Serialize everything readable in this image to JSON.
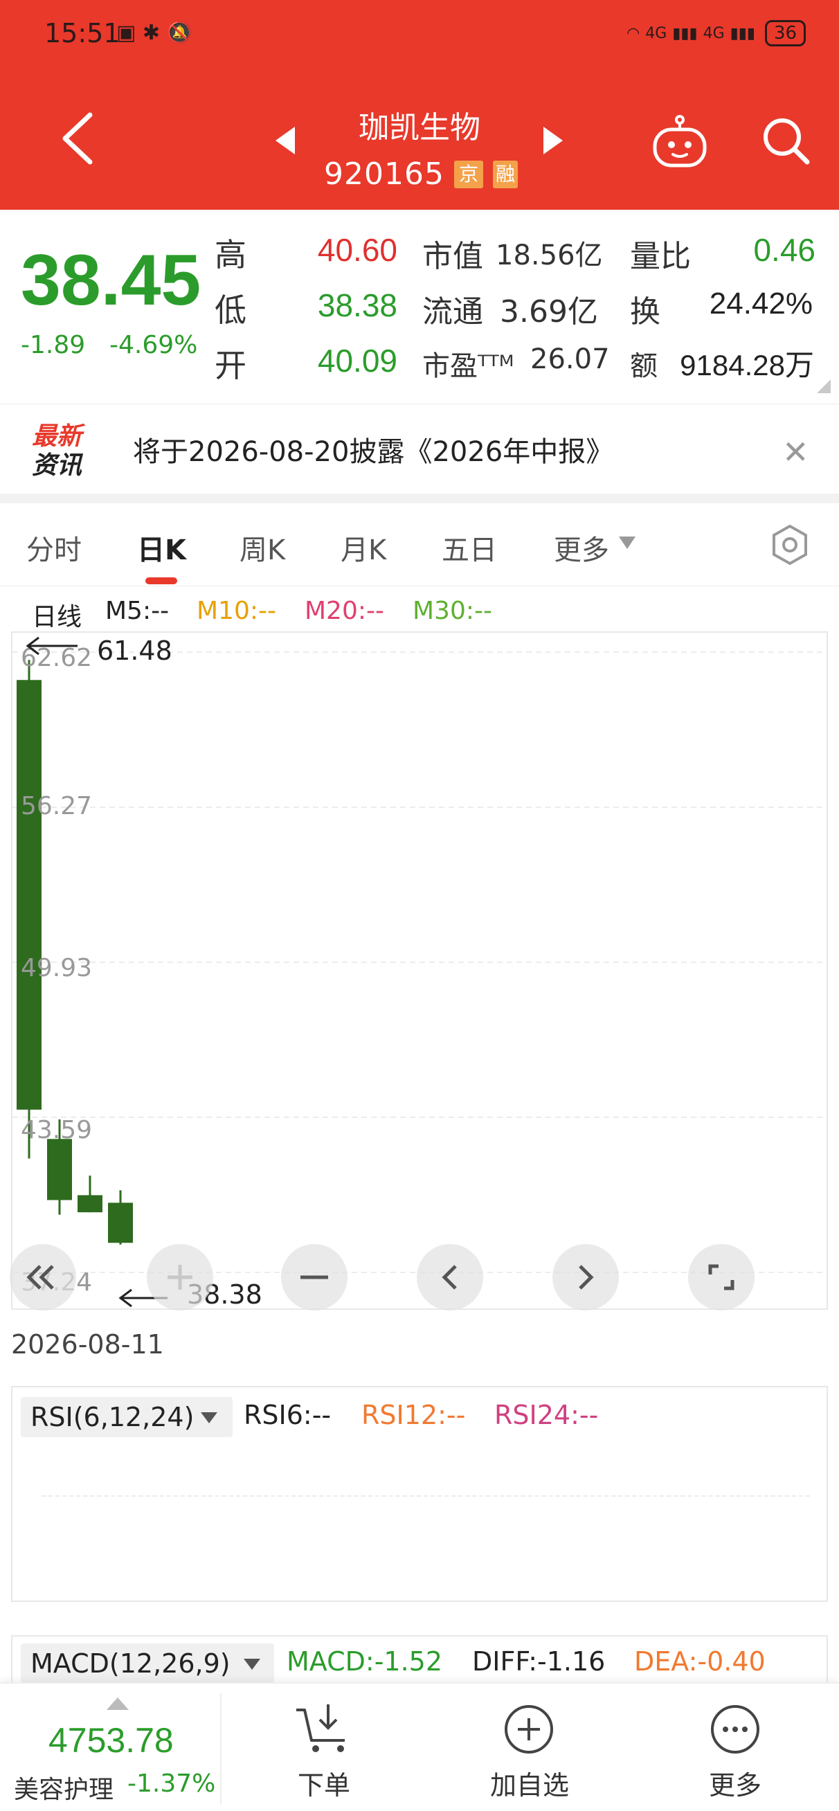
{
  "status_bar": {
    "time": "15:51",
    "network1": "4G",
    "network2": "4G",
    "battery": "36"
  },
  "header": {
    "stock_name": "珈凯生物",
    "stock_code": "920165",
    "tag_exchange": "京",
    "tag_extra": "融"
  },
  "quote": {
    "price": "38.45",
    "change_abs": "-1.89",
    "change_pct": "-4.69%",
    "high_label": "高",
    "high": "40.60",
    "low_label": "低",
    "low": "38.38",
    "open_label": "开",
    "open": "40.09",
    "mcap_label": "市值",
    "mcap": "18.56亿",
    "float_label": "流通",
    "float": "3.69亿",
    "pe_label": "市盈ᵀᵀᴹ",
    "pe": "26.07",
    "vol_ratio_label": "量比",
    "vol_ratio": "0.46",
    "turnover_label": "换",
    "turnover": "24.42%",
    "amount_label": "额",
    "amount": "9184.28万"
  },
  "news": {
    "logo_line1": "最新",
    "logo_line2": "资讯",
    "text": "将于2026-08-20披露《2026年中报》"
  },
  "tabs": [
    "分时",
    "日K",
    "周K",
    "月K",
    "五日",
    "更多"
  ],
  "active_tab": "日K",
  "legend": {
    "period": "日线",
    "m5": "M5:--",
    "m10": "M10:--",
    "m20": "M20:--",
    "m30": "M30:--"
  },
  "chart_data": {
    "type": "candlestick",
    "y_ticks": [
      "62.62",
      "56.27",
      "49.93",
      "43.59",
      "37.24"
    ],
    "ylim": [
      37.24,
      62.62
    ],
    "candles": [
      {
        "open": 61.48,
        "close": 43.9,
        "high": 62.3,
        "low": 41.9
      },
      {
        "open": 42.7,
        "close": 40.2,
        "high": 43.5,
        "low": 39.6
      },
      {
        "open": 40.4,
        "close": 39.7,
        "high": 41.2,
        "low": 39.7
      },
      {
        "open": 40.09,
        "close": 38.45,
        "high": 40.6,
        "low": 38.38
      }
    ],
    "high_marker": "61.48",
    "low_marker": "38.38",
    "date": "2026-08-11",
    "colors": {
      "down": "#2e6b1e"
    }
  },
  "rsi": {
    "select": "RSI(6,12,24)",
    "rsi6": "RSI6:--",
    "rsi12": "RSI12:--",
    "rsi24": "RSI24:--"
  },
  "macd": {
    "select": "MACD(12,26,9)",
    "macd": "MACD:-1.52",
    "diff": "DIFF:-1.16",
    "dea": "DEA:-0.40"
  },
  "bottom_nav": {
    "index_value": "4753.78",
    "index_name": "美容护理",
    "index_change": "-1.37%",
    "order": "下单",
    "add_watch": "加自选",
    "more": "更多"
  },
  "colors": {
    "brand": "#e8392b",
    "down": "#2b9c2b",
    "up": "#e03030"
  }
}
